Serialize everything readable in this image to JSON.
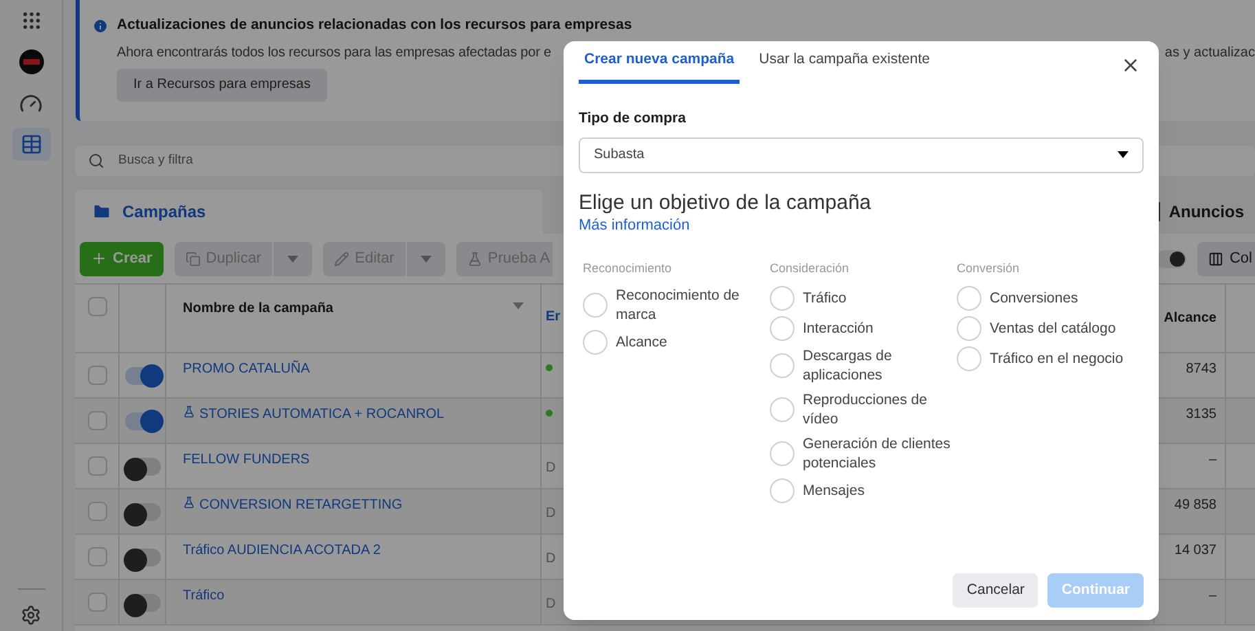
{
  "sidebar": {
    "items": [
      {
        "kind": "apps",
        "selected": false
      },
      {
        "kind": "account",
        "selected": false
      },
      {
        "kind": "dashboard",
        "selected": false
      },
      {
        "kind": "table",
        "selected": true
      },
      {
        "kind": "settings",
        "selected": false
      }
    ]
  },
  "banner": {
    "title": "Actualizaciones de anuncios relacionadas con los recursos para empresas",
    "text": "Ahora encontrarás todos los recursos para las empresas afectadas por e",
    "text_right": "as y actualizac",
    "button": "Ir a Recursos para empresas"
  },
  "search": {
    "placeholder": "Busca y filtra"
  },
  "panel": {
    "title": "Campañas",
    "tab_right": "Anuncios"
  },
  "toolbar": {
    "toggle_on": true,
    "buttons": [
      {
        "label": "Crear",
        "kind": "primary"
      },
      {
        "label": "Duplicar",
        "kind": "split"
      },
      {
        "label": "Editar",
        "kind": "split"
      },
      {
        "label": "Prueba A",
        "kind": "plain"
      }
    ],
    "columns_button": "Col"
  },
  "table": {
    "select_all": {
      "checked": false
    },
    "columns": [
      "Nombre de la campaña",
      "Er",
      "Alcance"
    ],
    "rows": [
      {
        "checked": false,
        "name": "PROMO CATALUÑA",
        "test": false,
        "on": true,
        "color": "#2f7a1e",
        "reach": "8743"
      },
      {
        "checked": false,
        "name": "STORIES AUTOMATICA + ROCANROL",
        "test": true,
        "on": true,
        "color": "#2f7a1e",
        "reach": "3135"
      },
      {
        "checked": false,
        "name": "FELLOW FUNDERS",
        "test": false,
        "on": false,
        "status": "D",
        "reach": "–"
      },
      {
        "checked": false,
        "name": "CONVERSION RETARGETTING",
        "test": true,
        "on": false,
        "status": "D",
        "reach": "49 858"
      },
      {
        "checked": false,
        "name": "Tráfico AUDIENCIA ACOTADA 2",
        "test": false,
        "on": false,
        "status": "D",
        "reach": "14 037"
      },
      {
        "checked": false,
        "name": "Tráfico",
        "test": false,
        "on": false,
        "status": "D",
        "reach": "–"
      }
    ]
  },
  "dialog": {
    "tabs": [
      {
        "label": "Crear nueva campaña",
        "selected": true
      },
      {
        "label": "Usar la campaña existente",
        "selected": false
      }
    ],
    "field_label": "Tipo de compra",
    "select_value": "Subasta",
    "heading": "Elige un objetivo de la campaña",
    "link": "Más información",
    "groups": [
      {
        "title": "Reconocimiento",
        "options": [
          {
            "label": "Reconocimiento de marca",
            "selected": false
          },
          {
            "label": "Alcance",
            "selected": false
          }
        ]
      },
      {
        "title": "Consideración",
        "options": [
          {
            "label": "Tráfico",
            "selected": false
          },
          {
            "label": "Interacción",
            "selected": false
          },
          {
            "label": "Descargas de aplicaciones",
            "selected": false
          },
          {
            "label": "Reproducciones de vídeo",
            "selected": false
          },
          {
            "label": "Generación de clientes potenciales",
            "selected": false
          },
          {
            "label": "Mensajes",
            "selected": false
          }
        ]
      },
      {
        "title": "Conversión",
        "options": [
          {
            "label": "Conversiones",
            "selected": false
          },
          {
            "label": "Ventas del catálogo",
            "selected": false
          },
          {
            "label": "Tráfico en el negocio",
            "selected": false
          }
        ]
      }
    ],
    "buttons": [
      {
        "label": "Cancelar",
        "kind": "secondary",
        "disabled": false
      },
      {
        "label": "Continuar",
        "kind": "primary",
        "disabled": true
      }
    ]
  }
}
